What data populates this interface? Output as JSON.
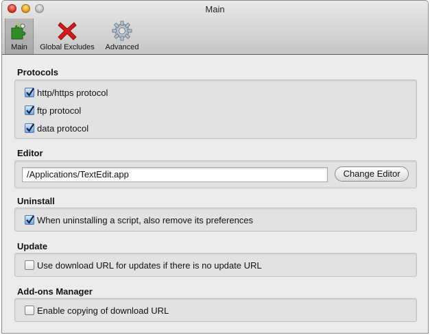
{
  "window": {
    "title": "Main"
  },
  "toolbar": {
    "items": [
      {
        "label": "Main",
        "icon": "puzzle-piece-icon",
        "selected": true
      },
      {
        "label": "Global Excludes",
        "icon": "red-x-icon",
        "selected": false
      },
      {
        "label": "Advanced",
        "icon": "gear-icon",
        "selected": false
      }
    ]
  },
  "sections": {
    "protocols": {
      "title": "Protocols",
      "options": [
        {
          "label": "http/https protocol",
          "checked": true
        },
        {
          "label": "ftp protocol",
          "checked": true
        },
        {
          "label": "data protocol",
          "checked": true
        }
      ]
    },
    "editor": {
      "title": "Editor",
      "path": "/Applications/TextEdit.app",
      "button": "Change Editor"
    },
    "uninstall": {
      "title": "Uninstall",
      "option": {
        "label": "When uninstalling a script, also remove its preferences",
        "checked": true
      }
    },
    "update": {
      "title": "Update",
      "option": {
        "label": "Use download URL for updates if there is no update URL",
        "checked": false
      }
    },
    "addons": {
      "title": "Add-ons Manager",
      "option": {
        "label": "Enable copying of download URL",
        "checked": false
      }
    }
  },
  "colors": {
    "checkbox_checked": "#6fa8e8",
    "close": "#d9362a",
    "minimize": "#e0a11c",
    "excludes_icon": "#d4191b",
    "main_icon": "#2f8c2a"
  }
}
